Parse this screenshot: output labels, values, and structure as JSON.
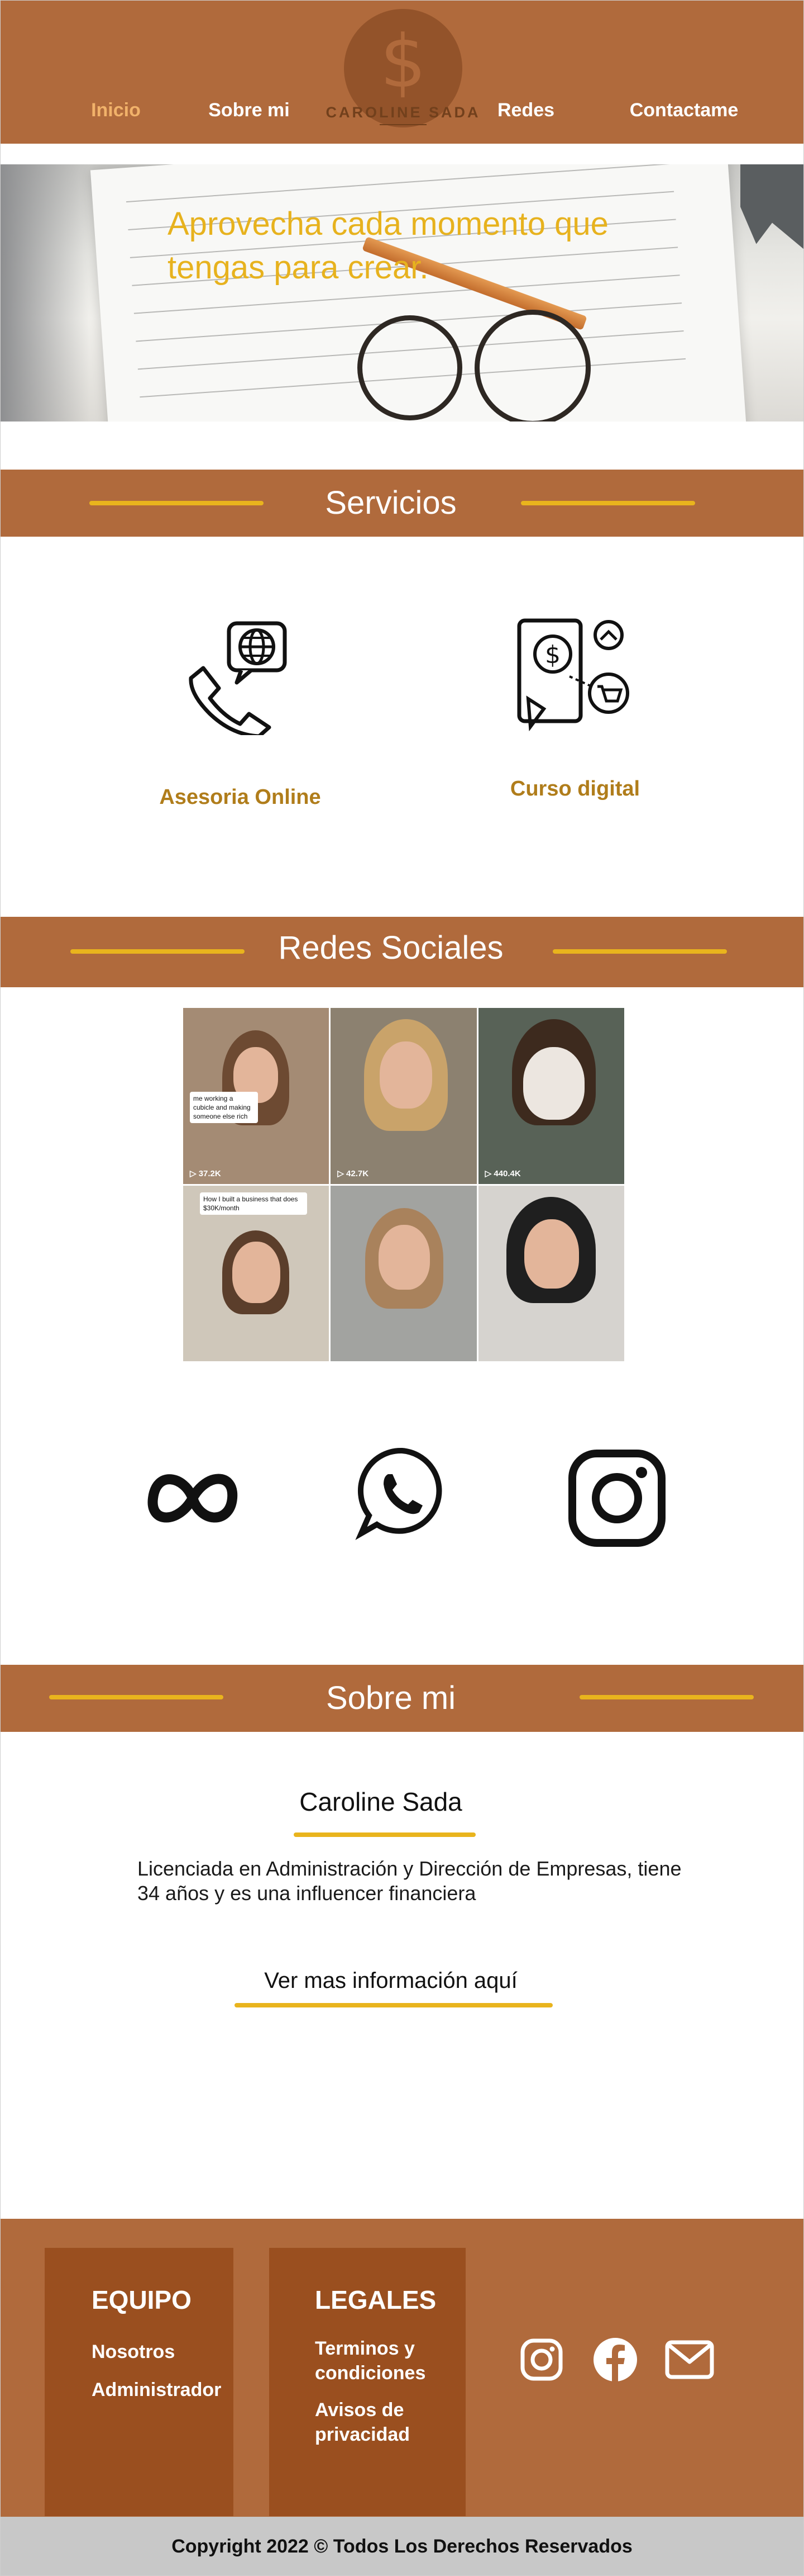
{
  "nav": {
    "items": [
      {
        "label": "Inicio",
        "active": true
      },
      {
        "label": "Sobre mi",
        "active": false
      },
      {
        "label": "Redes",
        "active": false
      },
      {
        "label": "Contactame",
        "active": false
      }
    ],
    "logo_text": "CAROLINE SADA",
    "logo_symbol": "$"
  },
  "hero": {
    "headline": "Aprovecha cada momento que tengas para crear."
  },
  "services": {
    "title": "Servicios",
    "items": [
      {
        "label": "Asesoria Online",
        "icon": "phone-globe-icon"
      },
      {
        "label": "Curso digital",
        "icon": "tablet-shopping-icon"
      }
    ]
  },
  "social": {
    "title": "Redes Sociales",
    "tiles": [
      {
        "caption": "me working a cubicle and making someone else rich",
        "views": "▷ 37.2K"
      },
      {
        "caption": "",
        "views": "▷ 42.7K"
      },
      {
        "caption": "",
        "views": "▷ 440.4K"
      },
      {
        "caption": "How I built a business that does $30K/month",
        "views": ""
      },
      {
        "caption": "",
        "views": ""
      },
      {
        "caption": "",
        "views": ""
      }
    ],
    "icons": [
      {
        "name": "meta-icon"
      },
      {
        "name": "whatsapp-icon"
      },
      {
        "name": "instagram-icon"
      }
    ]
  },
  "about": {
    "title": "Sobre mi",
    "name": "Caroline Sada",
    "description": "Licenciada en Administración y Dirección de Empresas, tiene 34 años y es una influencer financiera",
    "link": "Ver mas información aquí"
  },
  "footer": {
    "team": {
      "title": "EQUIPO",
      "items": [
        "Nosotros",
        "Administrador"
      ]
    },
    "legal": {
      "title": "LEGALES",
      "items": [
        "Terminos y condiciones",
        "Avisos de privacidad"
      ]
    },
    "icons": [
      {
        "name": "instagram-icon"
      },
      {
        "name": "facebook-icon"
      },
      {
        "name": "mail-icon"
      }
    ],
    "copyright": "Copyright 2022 © Todos Los Derechos Reservados"
  },
  "colors": {
    "brand_brown": "#b06a3c",
    "dark_brown": "#9a4f1f",
    "accent_yellow": "#e9b41d",
    "service_label": "#b07d1b",
    "active_nav": "#f1b26a"
  }
}
